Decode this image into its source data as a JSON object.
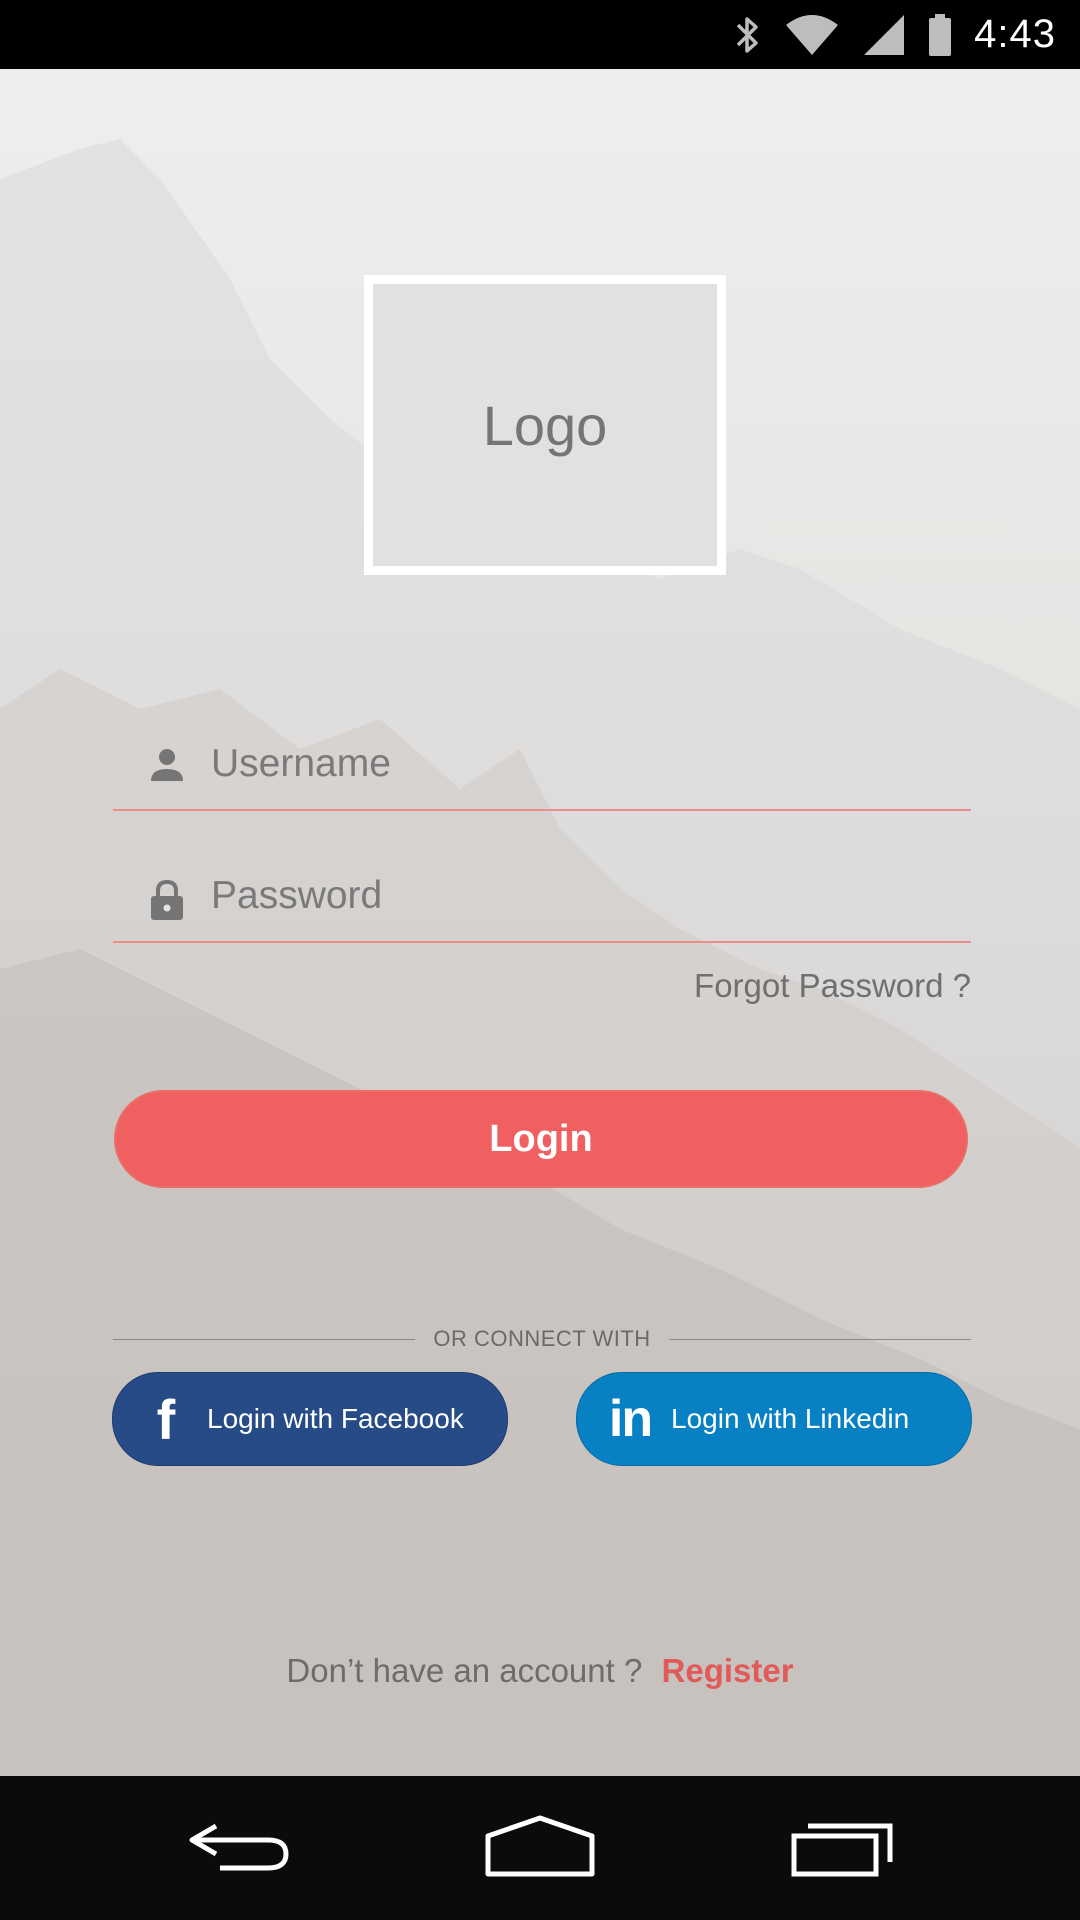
{
  "status_bar": {
    "time": "4:43",
    "icons": [
      "bluetooth-icon",
      "wifi-icon",
      "cell-signal-icon",
      "battery-icon"
    ]
  },
  "logo": {
    "text": "Logo"
  },
  "form": {
    "username_placeholder": "Username",
    "password_placeholder": "Password",
    "username_icon": "person-icon",
    "password_icon": "lock-icon",
    "forgot_password": "Forgot Password ?",
    "login_label": "Login"
  },
  "divider": {
    "text": "OR CONNECT WITH"
  },
  "social": {
    "facebook_label": "Login with Facebook",
    "facebook_glyph": "f",
    "linkedin_label": "Login with Linkedin",
    "linkedin_glyph": "in"
  },
  "footer": {
    "prompt": "Don’t have an account ?",
    "register": "Register"
  },
  "nav_bar": {
    "icons": [
      "back-icon",
      "home-icon",
      "recents-icon"
    ]
  },
  "colors": {
    "accent": "#f06060",
    "facebook": "#264b87",
    "linkedin": "#0880c4",
    "link": "#e05a5a"
  }
}
